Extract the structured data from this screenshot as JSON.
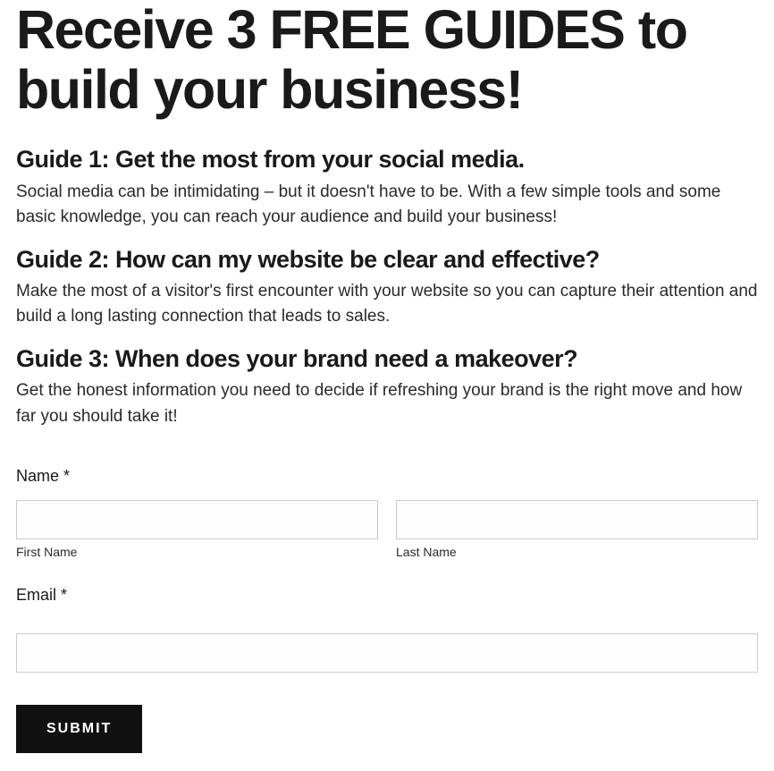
{
  "heading": "Receive 3 FREE GUIDES to build your business!",
  "guides": {
    "g1": {
      "title": "Guide 1: Get the most from your social media.",
      "description": "Social media can be intimidating – but it doesn't have to be. With a few simple tools and some basic knowledge, you can reach your audience and build your business!"
    },
    "g2": {
      "title": "Guide 2: How can my website be clear and effective?",
      "description": "Make the most of a visitor's first encounter with your website so you can capture their attention and build a long lasting connection that leads to sales."
    },
    "g3": {
      "title": "Guide 3: When does your brand need a makeover?",
      "description": "Get the honest information you need to decide if refreshing your brand is the right move and how far you should take it!"
    }
  },
  "form": {
    "name_label": "Name *",
    "first_name_sublabel": "First Name",
    "last_name_sublabel": "Last Name",
    "email_label": "Email *",
    "submit_label": "SUBMIT"
  }
}
